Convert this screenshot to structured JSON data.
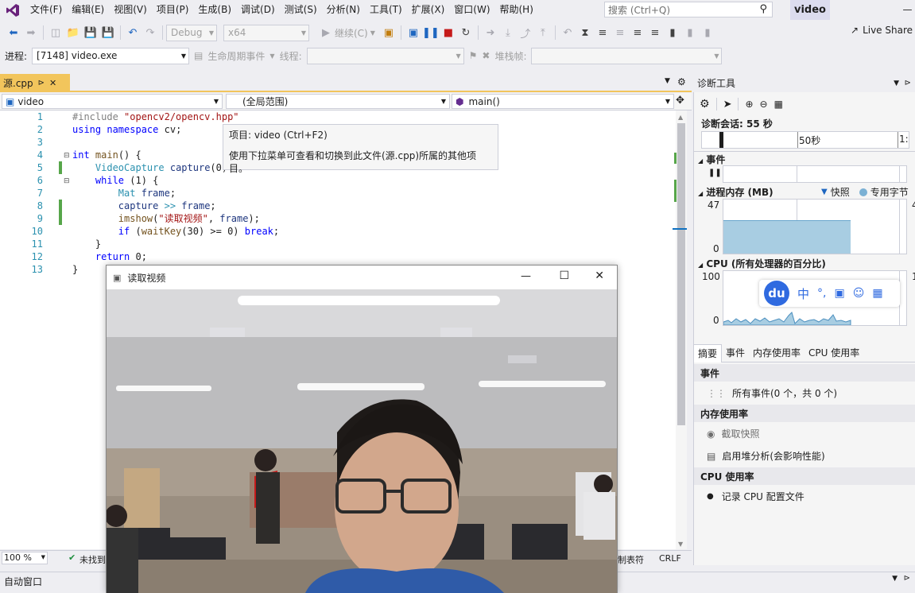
{
  "menu": {
    "items": [
      "文件(F)",
      "编辑(E)",
      "视图(V)",
      "项目(P)",
      "生成(B)",
      "调试(D)",
      "测试(S)",
      "分析(N)",
      "工具(T)",
      "扩展(X)",
      "窗口(W)",
      "帮助(H)"
    ],
    "search_placeholder": "搜索 (Ctrl+Q)",
    "app_title": "video"
  },
  "toolbar": {
    "config": "Debug",
    "platform": "x64",
    "continue_label": "继续(C)",
    "live_share": "Live Share"
  },
  "process_bar": {
    "process_label": "进程:",
    "process_value": "[7148] video.exe",
    "lifecycle_label": "生命周期事件",
    "thread_label": "线程:",
    "stack_label": "堆栈帧:"
  },
  "editor": {
    "tab_label": "源.cpp",
    "project_combo": "video",
    "scope_combo": "(全局范围)",
    "member_combo": "main()",
    "zoom": "100 %",
    "status_found": "未找到",
    "tab_mode": "制表符",
    "line_ending": "CRLF",
    "tooltip_title": "项目: video (Ctrl+F2)",
    "tooltip_body": "使用下拉菜单可查看和切换到此文件(源.cpp)所属的其他项目。",
    "line_numbers": [
      "1",
      "2",
      "3",
      "4",
      "5",
      "6",
      "7",
      "8",
      "9",
      "10",
      "11",
      "12",
      "13"
    ]
  },
  "diagnostics": {
    "panel_title": "诊断工具",
    "session_label": "诊断会话: 55 秒",
    "timeline_mark": "50秒",
    "timeline_end": "1:",
    "events_title": "事件",
    "memory_title": "进程内存 (MB)",
    "memory_legend_snapshot": "快照",
    "memory_legend_private": "专用字节",
    "memory_max": "47",
    "memory_min": "0",
    "memory_level_fraction": 0.62,
    "cpu_title": "CPU (所有处理器的百分比)",
    "cpu_max": "100",
    "cpu_min": "0",
    "tabs": [
      "摘要",
      "事件",
      "内存使用率",
      "CPU 使用率"
    ],
    "summary_events_head": "事件",
    "all_events": "所有事件(0 个，共 0 个)",
    "memory_usage_head": "内存使用率",
    "take_snapshot": "截取快照",
    "heap_analysis": "启用堆分析(会影响性能)",
    "cpu_usage_head": "CPU 使用率",
    "record_cpu": "记录 CPU 配置文件"
  },
  "auto_window": {
    "title": "自动窗口"
  },
  "video_window": {
    "title": "读取视频"
  },
  "ime_bar": {
    "chinese": "中"
  },
  "colors": {
    "accent": "#f2c55c",
    "vs_purple": "#68217a",
    "memory_fill": "#a8cde2",
    "line_numbers": "#2b91af"
  }
}
